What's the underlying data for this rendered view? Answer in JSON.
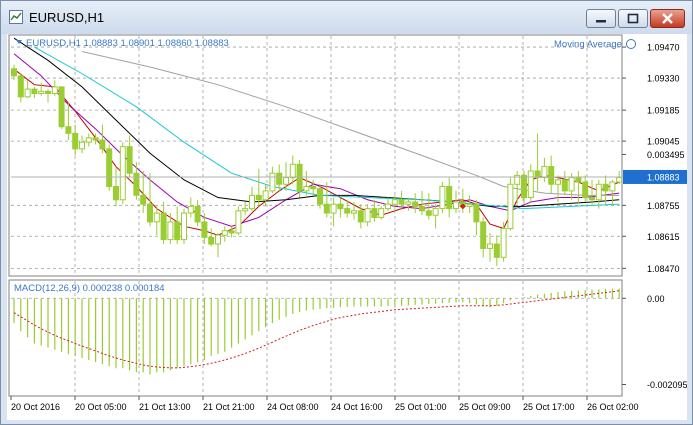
{
  "window": {
    "title": "EURUSD,H1",
    "icons": [
      "chart-window-icon",
      "minimize-icon",
      "maximize-icon",
      "close-icon"
    ]
  },
  "colors": {
    "background": "#ffffff",
    "grid": "#a0a0a0",
    "candle": "#9acd32",
    "ma_red": "#c00000",
    "ma_purple": "#9b00b0",
    "ma_black": "#000000",
    "ma_cyan": "#19c8d2",
    "ma_gray": "#a0a0a0",
    "text_blue": "#3a78c8",
    "signal": "#d02020",
    "price_tag": "#1f6fd0"
  },
  "chart_data": {
    "type": "candlestick",
    "symbol_info": "EURUSD,H1  1.08883 1.08901 1.08860 1.08883",
    "indicator_label": "Moving Average",
    "y_ticks": [
      "1.09470",
      "1.09330",
      "1.09185",
      "1.09045",
      "1.08755",
      "1.08615",
      "1.08470"
    ],
    "price_tick_values": [
      1.0947,
      1.0933,
      1.09185,
      1.09045,
      1.08755,
      1.08615,
      1.0847
    ],
    "current_price": "1.08883",
    "x_ticks": [
      "20 Oct 2016",
      "20 Oct 05:00",
      "21 Oct 13:00",
      "21 Oct 21:00",
      "24 Oct 08:00",
      "24 Oct 16:00",
      "25 Oct 01:00",
      "25 Oct 09:00",
      "25 Oct 17:00",
      "26 Oct 02:00"
    ],
    "bar_interval": 1,
    "candles": [
      [
        1.09372,
        1.0939,
        1.0932,
        1.0934
      ],
      [
        1.0934,
        1.0935,
        1.0922,
        1.09245
      ],
      [
        1.09245,
        1.0932,
        1.0924,
        1.0928
      ],
      [
        1.0928,
        1.0929,
        1.0924,
        1.0926
      ],
      [
        1.0926,
        1.0931,
        1.0925,
        1.0927
      ],
      [
        1.0927,
        1.0928,
        1.0922,
        1.0926
      ],
      [
        1.0926,
        1.0932,
        1.0925,
        1.0929
      ],
      [
        1.0929,
        1.0929,
        1.091,
        1.0911
      ],
      [
        1.0911,
        1.0922,
        1.0905,
        1.0908
      ],
      [
        1.0908,
        1.0912,
        1.0898,
        1.0901
      ],
      [
        1.0901,
        1.0907,
        1.0899,
        1.0904
      ],
      [
        1.0904,
        1.0908,
        1.0902,
        1.0906
      ],
      [
        1.0906,
        1.0908,
        1.0903,
        1.0905
      ],
      [
        1.0905,
        1.0912,
        1.0899,
        1.0901
      ],
      [
        1.0901,
        1.0903,
        1.0882,
        1.0884
      ],
      [
        1.0884,
        1.0893,
        1.0875,
        1.0878
      ],
      [
        1.0878,
        1.0904,
        1.0876,
        1.0902
      ],
      [
        1.0902,
        1.0907,
        1.0888,
        1.089
      ],
      [
        1.089,
        1.0895,
        1.0878,
        1.088
      ],
      [
        1.088,
        1.0891,
        1.0872,
        1.0876
      ],
      [
        1.0876,
        1.089,
        1.0866,
        1.0868
      ],
      [
        1.0868,
        1.0875,
        1.0862,
        1.0872
      ],
      [
        1.0872,
        1.0877,
        1.0858,
        1.086
      ],
      [
        1.086,
        1.0872,
        1.0858,
        1.0868
      ],
      [
        1.0868,
        1.0875,
        1.0858,
        1.086
      ],
      [
        1.086,
        1.0874,
        1.0858,
        1.0872
      ],
      [
        1.0872,
        1.0879,
        1.087,
        1.0875
      ],
      [
        1.0875,
        1.0878,
        1.0866,
        1.0868
      ],
      [
        1.0868,
        1.0872,
        1.0858,
        1.0861
      ],
      [
        1.0861,
        1.0865,
        1.0857,
        1.0858
      ],
      [
        1.0858,
        1.0863,
        1.0852,
        1.0862
      ],
      [
        1.0862,
        1.0866,
        1.0859,
        1.0864
      ],
      [
        1.0864,
        1.0866,
        1.0861,
        1.0863
      ],
      [
        1.0863,
        1.0875,
        1.0862,
        1.0873
      ],
      [
        1.0873,
        1.0877,
        1.0871,
        1.0874
      ],
      [
        1.0874,
        1.0884,
        1.0873,
        1.088
      ],
      [
        1.088,
        1.0892,
        1.0875,
        1.0878
      ],
      [
        1.0878,
        1.0885,
        1.0875,
        1.0882
      ],
      [
        1.0882,
        1.0893,
        1.0881,
        1.089
      ],
      [
        1.089,
        1.0894,
        1.0882,
        1.0885
      ],
      [
        1.0885,
        1.0895,
        1.0882,
        1.0888
      ],
      [
        1.0888,
        1.0898,
        1.0885,
        1.0894
      ],
      [
        1.0894,
        1.0896,
        1.0879,
        1.0882
      ],
      [
        1.0882,
        1.0891,
        1.088,
        1.0884
      ],
      [
        1.0884,
        1.0887,
        1.088,
        1.0883
      ],
      [
        1.0883,
        1.0885,
        1.0874,
        1.0876
      ],
      [
        1.0876,
        1.0886,
        1.087,
        1.0872
      ],
      [
        1.0872,
        1.0879,
        1.0866,
        1.0876
      ],
      [
        1.0876,
        1.0879,
        1.087,
        1.0874
      ],
      [
        1.0874,
        1.0878,
        1.087,
        1.0872
      ],
      [
        1.0872,
        1.0877,
        1.0869,
        1.0873
      ],
      [
        1.0873,
        1.0876,
        1.0865,
        1.0868
      ],
      [
        1.0868,
        1.0876,
        1.0866,
        1.0874
      ],
      [
        1.0874,
        1.0878,
        1.0868,
        1.087
      ],
      [
        1.087,
        1.0875,
        1.0869,
        1.0874
      ],
      [
        1.0874,
        1.0879,
        1.0873,
        1.0876
      ],
      [
        1.0876,
        1.088,
        1.0872,
        1.0878
      ],
      [
        1.0878,
        1.0882,
        1.0874,
        1.0876
      ],
      [
        1.0876,
        1.0879,
        1.0873,
        1.0877
      ],
      [
        1.0877,
        1.0881,
        1.0872,
        1.0875
      ],
      [
        1.0875,
        1.0882,
        1.0871,
        1.0873
      ],
      [
        1.0873,
        1.0881,
        1.0869,
        1.0871
      ],
      [
        1.0871,
        1.0876,
        1.0865,
        1.0874
      ],
      [
        1.0874,
        1.0886,
        1.0872,
        1.0884
      ],
      [
        1.0884,
        1.0888,
        1.087,
        1.0874
      ],
      [
        1.0874,
        1.0882,
        1.0872,
        1.0877
      ],
      [
        1.0877,
        1.0883,
        1.0872,
        1.0875
      ],
      [
        1.0875,
        1.088,
        1.0872,
        1.0876
      ],
      [
        1.0876,
        1.0878,
        1.0862,
        1.0868
      ],
      [
        1.0868,
        1.087,
        1.0852,
        1.0856
      ],
      [
        1.0856,
        1.0863,
        1.085,
        1.0858
      ],
      [
        1.0858,
        1.0862,
        1.0848,
        1.0852
      ],
      [
        1.0852,
        1.0868,
        1.085,
        1.0865
      ],
      [
        1.0865,
        1.0888,
        1.0864,
        1.0885
      ],
      [
        1.0885,
        1.0891,
        1.0876,
        1.0889
      ],
      [
        1.0889,
        1.0891,
        1.0876,
        1.0879
      ],
      [
        1.0879,
        1.0894,
        1.0877,
        1.0891
      ],
      [
        1.0891,
        1.0908,
        1.0882,
        1.0888
      ],
      [
        1.0888,
        1.0897,
        1.0886,
        1.0893
      ],
      [
        1.0893,
        1.0898,
        1.0881,
        1.0885
      ],
      [
        1.0885,
        1.0889,
        1.0877,
        1.0887
      ],
      [
        1.0887,
        1.0891,
        1.088,
        1.0882
      ],
      [
        1.0882,
        1.089,
        1.0878,
        1.0888
      ],
      [
        1.0888,
        1.0891,
        1.0876,
        1.0886
      ],
      [
        1.0886,
        1.0889,
        1.0877,
        1.0879
      ],
      [
        1.0879,
        1.0887,
        1.0875,
        1.0878
      ],
      [
        1.0878,
        1.0887,
        1.0874,
        1.0885
      ],
      [
        1.0885,
        1.0889,
        1.0876,
        1.0882
      ],
      [
        1.0882,
        1.0887,
        1.0876,
        1.0886
      ],
      [
        1.0886,
        1.0891,
        1.0885,
        1.0888
      ]
    ],
    "moving_averages": [
      {
        "color": "#c00000",
        "points": [
          [
            0,
            1.0937
          ],
          [
            3,
            1.093
          ],
          [
            6,
            1.0929
          ],
          [
            9,
            1.0918
          ],
          [
            12,
            1.0906
          ],
          [
            15,
            1.0893
          ],
          [
            18,
            1.0884
          ],
          [
            21,
            1.0874
          ],
          [
            25,
            1.0866
          ],
          [
            28,
            1.0864
          ],
          [
            30,
            1.0862
          ],
          [
            33,
            1.0866
          ],
          [
            36,
            1.0875
          ],
          [
            39,
            1.0882
          ],
          [
            42,
            1.0888
          ],
          [
            45,
            1.0884
          ],
          [
            48,
            1.0879
          ],
          [
            51,
            1.0874
          ],
          [
            54,
            1.0871
          ],
          [
            57,
            1.0874
          ],
          [
            60,
            1.0876
          ],
          [
            63,
            1.0877
          ],
          [
            66,
            1.0878
          ],
          [
            68,
            1.0876
          ],
          [
            70,
            1.0867
          ],
          [
            72,
            1.0865
          ],
          [
            74,
            1.0878
          ],
          [
            76,
            1.0887
          ],
          [
            78,
            1.0889
          ],
          [
            80,
            1.0888
          ],
          [
            83,
            1.0886
          ],
          [
            86,
            1.0882
          ],
          [
            89,
            1.0886
          ]
        ]
      },
      {
        "color": "#9b00b0",
        "points": [
          [
            0,
            1.0944
          ],
          [
            4,
            1.0934
          ],
          [
            8,
            1.0921
          ],
          [
            12,
            1.091
          ],
          [
            16,
            1.0898
          ],
          [
            20,
            1.0887
          ],
          [
            24,
            1.0877
          ],
          [
            28,
            1.087
          ],
          [
            32,
            1.0866
          ],
          [
            36,
            1.087
          ],
          [
            40,
            1.0878
          ],
          [
            44,
            1.0885
          ],
          [
            48,
            1.0883
          ],
          [
            52,
            1.0878
          ],
          [
            56,
            1.0875
          ],
          [
            60,
            1.0874
          ],
          [
            64,
            1.0876
          ],
          [
            67,
            1.0878
          ],
          [
            70,
            1.0875
          ],
          [
            73,
            1.0873
          ],
          [
            76,
            1.0877
          ],
          [
            80,
            1.0879
          ],
          [
            84,
            1.0879
          ],
          [
            89,
            1.0881
          ]
        ]
      },
      {
        "color": "#000000",
        "points": [
          [
            0,
            1.0951
          ],
          [
            5,
            1.0941
          ],
          [
            10,
            1.0929
          ],
          [
            15,
            1.0914
          ],
          [
            20,
            1.0899
          ],
          [
            25,
            1.0887
          ],
          [
            30,
            1.0879
          ],
          [
            35,
            1.0877
          ],
          [
            40,
            1.0878
          ],
          [
            45,
            1.088
          ],
          [
            50,
            1.088
          ],
          [
            55,
            1.0879
          ],
          [
            60,
            1.0878
          ],
          [
            65,
            1.0877
          ],
          [
            70,
            1.0875
          ],
          [
            75,
            1.0875
          ],
          [
            80,
            1.0876
          ],
          [
            85,
            1.0877
          ],
          [
            89,
            1.0878
          ]
        ]
      },
      {
        "color": "#19c8d2",
        "points": [
          [
            3,
            1.0947
          ],
          [
            10,
            1.0935
          ],
          [
            18,
            1.092
          ],
          [
            25,
            1.0904
          ],
          [
            32,
            1.089
          ],
          [
            38,
            1.0884
          ],
          [
            45,
            1.088
          ],
          [
            52,
            1.0879
          ],
          [
            60,
            1.0878
          ],
          [
            68,
            1.0876
          ],
          [
            75,
            1.0874
          ],
          [
            82,
            1.0875
          ],
          [
            89,
            1.0876
          ]
        ]
      },
      {
        "color": "#a0a0a0",
        "points": [
          [
            10,
            1.0945
          ],
          [
            20,
            1.0938
          ],
          [
            30,
            1.093
          ],
          [
            40,
            1.092
          ],
          [
            50,
            1.0909
          ],
          [
            60,
            1.0898
          ],
          [
            68,
            1.0889
          ],
          [
            72,
            1.0884
          ],
          [
            78,
            1.0881
          ],
          [
            84,
            1.088
          ],
          [
            89,
            1.088
          ]
        ]
      }
    ],
    "signal_markers": [
      {
        "bar": 66,
        "value": 1.0875
      }
    ],
    "macd": {
      "label": "MACD(12,26,9) 0.000238 0.000184",
      "y_ticks": [
        "0.003495",
        "0.00",
        "-0.002095"
      ],
      "y_tick_values": [
        0.003495,
        0.0,
        -0.002095
      ],
      "histogram": [
        -0.0006,
        -0.0008,
        -0.00095,
        -0.0011,
        -0.00115,
        -0.0012,
        -0.00125,
        -0.0013,
        -0.00135,
        -0.0014,
        -0.00145,
        -0.0015,
        -0.00155,
        -0.0016,
        -0.00165,
        -0.0017,
        -0.0017,
        -0.00175,
        -0.0018,
        -0.0018,
        -0.00185,
        -0.0018,
        -0.0018,
        -0.00175,
        -0.0017,
        -0.00165,
        -0.0016,
        -0.00155,
        -0.0015,
        -0.0014,
        -0.00135,
        -0.0013,
        -0.0012,
        -0.0011,
        -0.001,
        -0.0009,
        -0.0008,
        -0.0007,
        -0.0006,
        -0.00052,
        -0.00045,
        -0.00038,
        -0.00033,
        -0.0003,
        -0.00028,
        -0.00026,
        -0.00024,
        -0.00023,
        -0.00022,
        -0.00021,
        -0.0002,
        -0.0002,
        -0.0002,
        -0.0002,
        -0.0002,
        -0.00019,
        -0.00018,
        -0.00018,
        -0.00017,
        -0.00016,
        -0.00015,
        -0.00014,
        -0.00013,
        -0.00012,
        -0.00011,
        -0.0001,
        -0.0001,
        -0.00012,
        -0.00015,
        -0.0002,
        -0.00022,
        -0.00018,
        -0.00012,
        -5e-05,
        0.0,
        3e-05,
        6e-05,
        9e-05,
        0.00011,
        0.00013,
        0.00015,
        0.00017,
        0.00018,
        0.00019,
        0.0002,
        0.00021,
        0.00022,
        0.00023,
        0.000235,
        0.000238
      ],
      "signal": [
        -0.00035,
        -0.00045,
        -0.00055,
        -0.00065,
        -0.00074,
        -0.00082,
        -0.0009,
        -0.00097,
        -0.00103,
        -0.0011,
        -0.00116,
        -0.00122,
        -0.00128,
        -0.00134,
        -0.0014,
        -0.00145,
        -0.0015,
        -0.00154,
        -0.00158,
        -0.00162,
        -0.00165,
        -0.00167,
        -0.00168,
        -0.00169,
        -0.00169,
        -0.00168,
        -0.00166,
        -0.00164,
        -0.00161,
        -0.00158,
        -0.00154,
        -0.0015,
        -0.00145,
        -0.0014,
        -0.00134,
        -0.00128,
        -0.00121,
        -0.00114,
        -0.00107,
        -0.00099,
        -0.00092,
        -0.00085,
        -0.00078,
        -0.00072,
        -0.00066,
        -0.00061,
        -0.00056,
        -0.00051,
        -0.00047,
        -0.00044,
        -0.00041,
        -0.00038,
        -0.00036,
        -0.00034,
        -0.00032,
        -0.0003,
        -0.00028,
        -0.00027,
        -0.00026,
        -0.00025,
        -0.00024,
        -0.00023,
        -0.00022,
        -0.00021,
        -0.0002,
        -0.00019,
        -0.00018,
        -0.00018,
        -0.00018,
        -0.00018,
        -0.00018,
        -0.00017,
        -0.00016,
        -0.00014,
        -0.00012,
        -0.0001,
        -8e-05,
        -6e-05,
        -4e-05,
        -2e-05,
        0.0,
        2e-05,
        4e-05,
        6e-05,
        8e-05,
        0.0001,
        0.00012,
        0.00014,
        0.00016,
        0.000184
      ]
    }
  }
}
